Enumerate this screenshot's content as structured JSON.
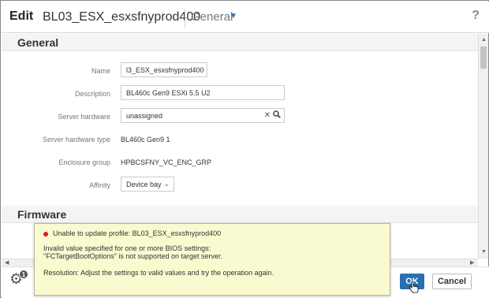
{
  "header": {
    "edit_label": "Edit",
    "profile_name": "BL03_ESX_esxsfnyprod400",
    "view_selector": "General",
    "help_icon": "?"
  },
  "sections": {
    "general_title": "General",
    "firmware_title": "Firmware"
  },
  "form": {
    "name_label": "Name",
    "name_value": "l3_ESX_esxsfnyprod400",
    "description_label": "Description",
    "description_value": "BL460c Gen9 ESXi 5.5 U2",
    "server_hardware_label": "Server hardware",
    "server_hardware_value": "unassigned",
    "server_hardware_type_label": "Server hardware type",
    "server_hardware_type_value": "BL460c Gen9 1",
    "enclosure_group_label": "Enclosure group",
    "enclosure_group_value": "HPBCSFNY_VC_ENC_GRP",
    "affinity_label": "Affinity",
    "affinity_value": "Device bay"
  },
  "error": {
    "title": "Unable to update profile: BL03_ESX_esxsfnyprod400",
    "line1": "Invalid value specified for one or more BIOS settings:",
    "line2": "\"FCTargetBootOptions\" is not supported on target server.",
    "line3": "Resolution: Adjust the settings to valid values and try the operation again.",
    "status_color": "#d81e1e"
  },
  "footer": {
    "activity_count": "1",
    "ok_label": "OK",
    "cancel_label": "Cancel"
  },
  "colors": {
    "accent": "#2a6fb0",
    "error_background": "#fafad0"
  },
  "icons": [
    "help-icon",
    "chevron-down-icon",
    "clear-icon",
    "search-icon",
    "gear-icon",
    "error-icon",
    "hand-cursor-icon"
  ]
}
